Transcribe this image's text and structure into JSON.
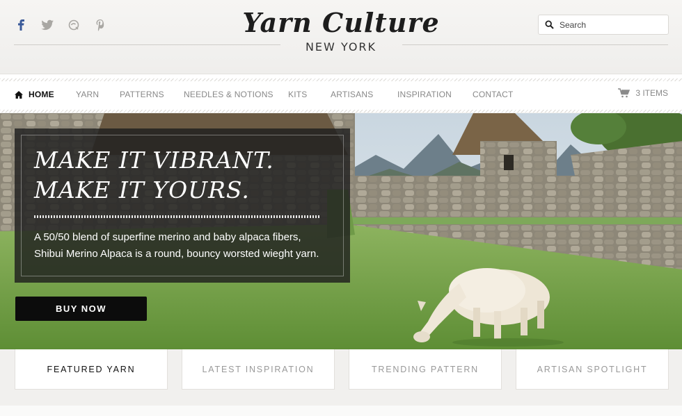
{
  "header": {
    "brand_title": "Yarn Culture",
    "brand_subtitle": "NEW YORK",
    "search_placeholder": "Search",
    "social_icons": [
      "facebook-icon",
      "twitter-icon",
      "chat-icon",
      "pinterest-icon"
    ]
  },
  "nav": {
    "items": [
      {
        "label": "HOME",
        "active": true
      },
      {
        "label": "YARN"
      },
      {
        "label": "PATTERNS"
      },
      {
        "label": "NEEDLES & NOTIONS"
      },
      {
        "label": "KITS"
      },
      {
        "label": "ARTISANS"
      },
      {
        "label": "INSPIRATION"
      },
      {
        "label": "CONTACT"
      }
    ],
    "cart_label": "3 ITEMS"
  },
  "hero": {
    "headline_line1": "MAKE IT VIBRANT.",
    "headline_line2": "MAKE IT YOURS.",
    "description_line1": "A 50/50 blend of superfine merino and baby alpaca fibers,",
    "description_line2": "Shibui Merino Alpaca is a round, bouncy worsted wieght yarn.",
    "button_label": "BUY NOW"
  },
  "cards": [
    {
      "label": "FEATURED YARN",
      "active": true
    },
    {
      "label": "LATEST INSPIRATION"
    },
    {
      "label": "TRENDING PATTERN"
    },
    {
      "label": "ARTISAN SPOTLIGHT"
    }
  ],
  "colors": {
    "page_bg": "#f1f0ee",
    "dark_button": "#0c0c0c",
    "nav_active": "#111111",
    "nav_inactive": "#888888"
  }
}
